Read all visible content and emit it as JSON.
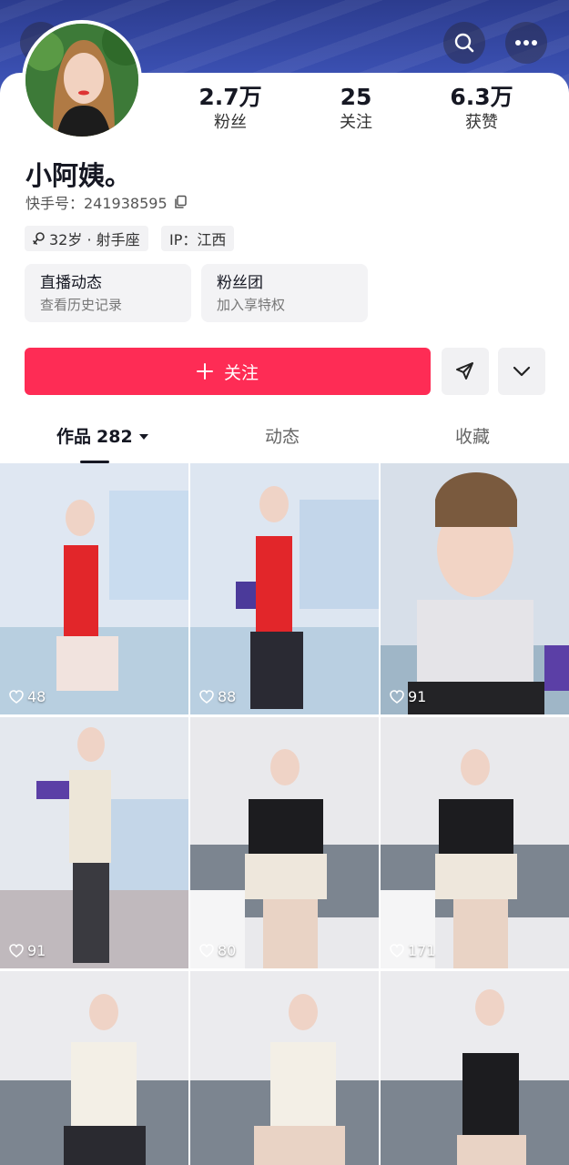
{
  "header": {
    "back_icon": "chevron-left-icon",
    "search_icon": "search-icon",
    "more_icon": "more-horizontal-icon"
  },
  "profile": {
    "name": "小阿姨。",
    "id_text": "快手号：241938595",
    "stats": [
      {
        "num": "2.7万",
        "label": "粉丝"
      },
      {
        "num": "25",
        "label": "关注"
      },
      {
        "num": "6.3万",
        "label": "获赞"
      }
    ],
    "tags": [
      {
        "text": "32岁 · 射手座",
        "icon": "female-icon"
      },
      {
        "text": "IP：江西"
      }
    ],
    "cards": [
      {
        "title": "直播动态",
        "subtitle": "查看历史记录"
      },
      {
        "title": "粉丝团",
        "subtitle": "加入享特权"
      }
    ]
  },
  "actions": {
    "follow_label": "关注",
    "share_icon": "send-icon",
    "more_icon": "chevron-down-icon",
    "accent_color": "#fe2c55"
  },
  "tabs": {
    "works_label": "作品",
    "works_count": "282",
    "dynamic_label": "动态",
    "favorites_label": "收藏"
  },
  "videos": [
    {
      "likes": "48"
    },
    {
      "likes": "88"
    },
    {
      "likes": "91"
    },
    {
      "likes": "91"
    },
    {
      "likes": "80"
    },
    {
      "likes": "171"
    },
    {
      "likes": ""
    },
    {
      "likes": ""
    },
    {
      "likes": ""
    }
  ]
}
